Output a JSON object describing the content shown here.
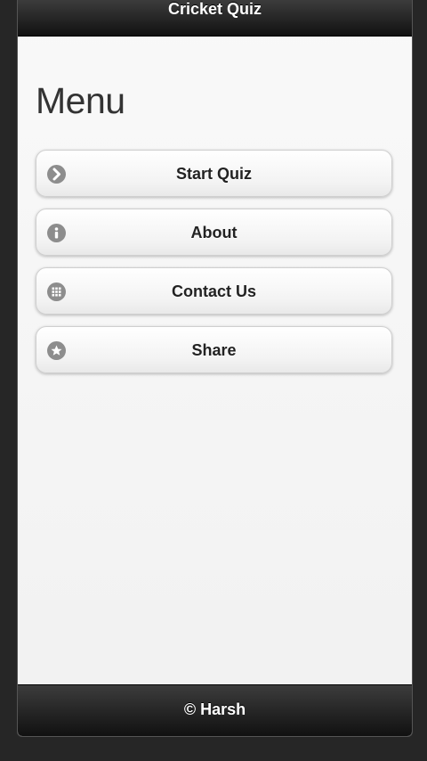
{
  "header": {
    "title": "Cricket Quiz"
  },
  "page": {
    "title": "Menu"
  },
  "menu": {
    "items": [
      {
        "label": "Start Quiz",
        "icon": "chevron-right-icon"
      },
      {
        "label": "About",
        "icon": "info-icon"
      },
      {
        "label": "Contact Us",
        "icon": "grid-icon"
      },
      {
        "label": "Share",
        "icon": "star-icon"
      }
    ]
  },
  "footer": {
    "text": "© Harsh"
  },
  "colors": {
    "header_bg": "#111111",
    "content_bg": "#f4f4f4",
    "button_bg": "#f3f3f3",
    "icon_bg": "#8d8d8d",
    "text": "#222222"
  }
}
